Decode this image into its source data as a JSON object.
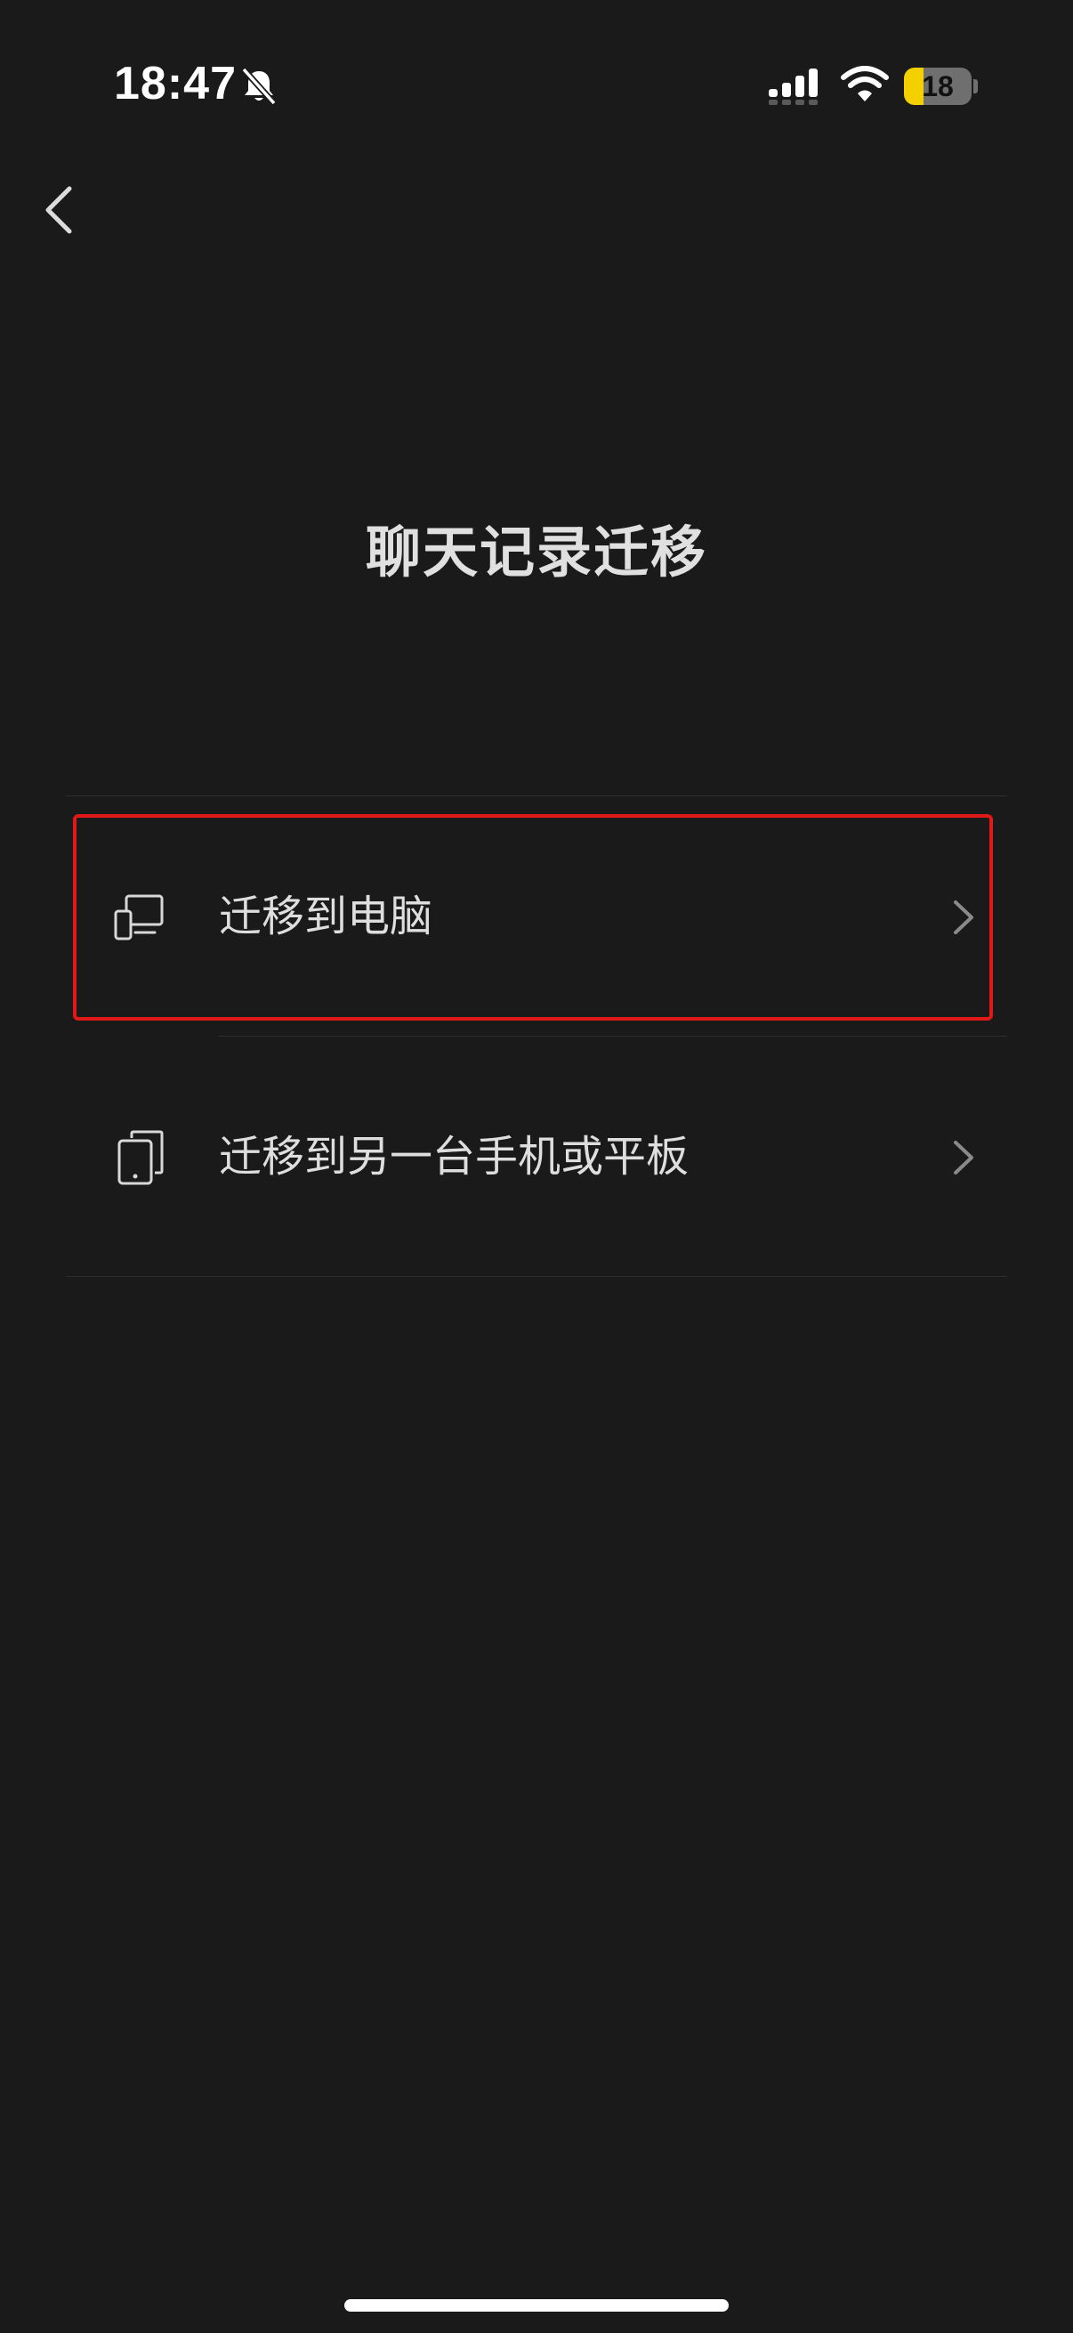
{
  "status_bar": {
    "time": "18:47",
    "battery_level": "18",
    "battery_fraction": 0.18,
    "mute_icon": "bell-slash-icon",
    "signal_icon": "cellular-signal-icon",
    "wifi_icon": "wifi-icon"
  },
  "nav": {
    "back_icon": "chevron-left-icon"
  },
  "page": {
    "title": "聊天记录迁移"
  },
  "options": [
    {
      "label": "迁移到电脑",
      "icon": "computer-icon",
      "chevron_icon": "chevron-right-icon",
      "highlighted": true
    },
    {
      "label": "迁移到另一台手机或平板",
      "icon": "phone-tablet-icon",
      "chevron_icon": "chevron-right-icon",
      "highlighted": false
    }
  ],
  "colors": {
    "background": "#1a1a1a",
    "text": "#dedede",
    "highlight": "#e01818",
    "battery_low": "#f4d000"
  }
}
